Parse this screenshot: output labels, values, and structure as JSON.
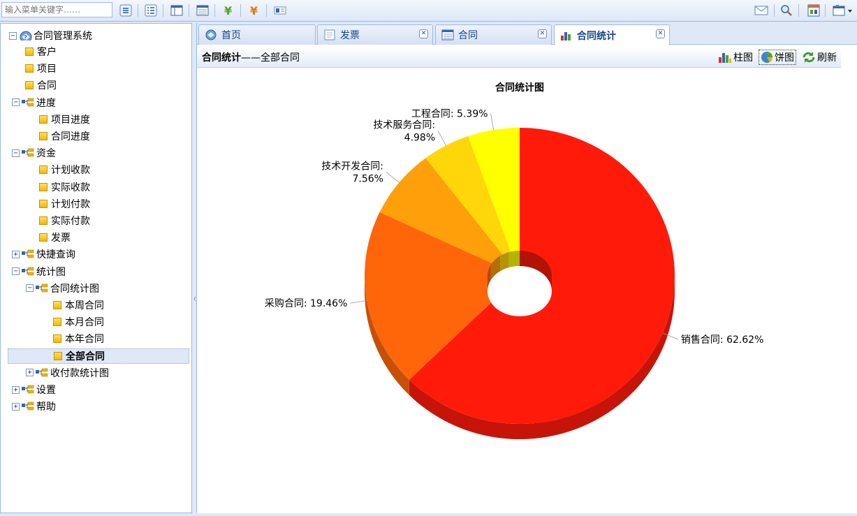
{
  "toolbar": {
    "search_placeholder": "输入菜单关键字……",
    "icons": [
      "expand-all-icon",
      "collapse-all-icon",
      "layout-icon",
      "list-icon",
      "yuan-green-icon",
      "yuan-orange-icon",
      "card-icon",
      "mail-icon",
      "search-icon",
      "window-icon",
      "windows-dropdown-icon"
    ]
  },
  "tree": {
    "root": "合同管理系统",
    "items": [
      {
        "label": "客户",
        "type": "leaf",
        "level": 1
      },
      {
        "label": "项目",
        "type": "leaf",
        "level": 1
      },
      {
        "label": "合同",
        "type": "leaf",
        "level": 1
      },
      {
        "label": "进度",
        "type": "folder",
        "level": 1,
        "expanded": true
      },
      {
        "label": "项目进度",
        "type": "leaf",
        "level": 2
      },
      {
        "label": "合同进度",
        "type": "leaf",
        "level": 2
      },
      {
        "label": "资金",
        "type": "folder",
        "level": 1,
        "expanded": true
      },
      {
        "label": "计划收款",
        "type": "leaf",
        "level": 2
      },
      {
        "label": "实际收款",
        "type": "leaf",
        "level": 2
      },
      {
        "label": "计划付款",
        "type": "leaf",
        "level": 2
      },
      {
        "label": "实际付款",
        "type": "leaf",
        "level": 2
      },
      {
        "label": "发票",
        "type": "leaf",
        "level": 2
      },
      {
        "label": "快捷查询",
        "type": "folder",
        "level": 1,
        "expanded": false
      },
      {
        "label": "统计图",
        "type": "folder",
        "level": 1,
        "expanded": true
      },
      {
        "label": "合同统计图",
        "type": "folder",
        "level": 2,
        "expanded": true
      },
      {
        "label": "本周合同",
        "type": "leaf",
        "level": 3
      },
      {
        "label": "本月合同",
        "type": "leaf",
        "level": 3
      },
      {
        "label": "本年合同",
        "type": "leaf",
        "level": 3
      },
      {
        "label": "全部合同",
        "type": "leaf",
        "level": 3,
        "selected": true
      },
      {
        "label": "收付款统计图",
        "type": "folder",
        "level": 2,
        "expanded": false
      },
      {
        "label": "设置",
        "type": "folder",
        "level": 1,
        "expanded": false
      },
      {
        "label": "帮助",
        "type": "folder",
        "level": 1,
        "expanded": false
      }
    ]
  },
  "tabs": [
    {
      "label": "首页",
      "closable": false,
      "active": false,
      "icon": "home-icon"
    },
    {
      "label": "发票",
      "closable": true,
      "active": false,
      "icon": "document-icon"
    },
    {
      "label": "合同",
      "closable": true,
      "active": false,
      "icon": "grid-icon"
    },
    {
      "label": "合同统计",
      "closable": true,
      "active": true,
      "icon": "bar-chart-icon"
    }
  ],
  "panel": {
    "title_bold": "合同统计",
    "title_rest": "——全部合同",
    "actions": [
      {
        "label": "柱图",
        "icon": "bar-chart-icon",
        "active": false
      },
      {
        "label": "饼图",
        "icon": "pie-chart-icon",
        "active": true
      },
      {
        "label": "刷新",
        "icon": "refresh-icon",
        "active": false
      }
    ]
  },
  "chart_data": {
    "type": "pie",
    "title": "合同统计图",
    "donut": true,
    "three_d": true,
    "slices": [
      {
        "label": "销售合同",
        "pct_label": "62.62%",
        "value": 62.62,
        "color": "#ff1a0a"
      },
      {
        "label": "采购合同",
        "pct_label": "19.46%",
        "value": 19.46,
        "color": "#ff660a"
      },
      {
        "label": "技术开发合同",
        "pct_label": "7.56%",
        "value": 7.56,
        "color": "#ff9f0a"
      },
      {
        "label": "技术服务合同",
        "pct_label": "4.98%",
        "value": 4.98,
        "color": "#ffd60a"
      },
      {
        "label": "工程合同",
        "pct_label": "5.39%",
        "value": 5.39,
        "color": "#ffff00"
      }
    ]
  }
}
